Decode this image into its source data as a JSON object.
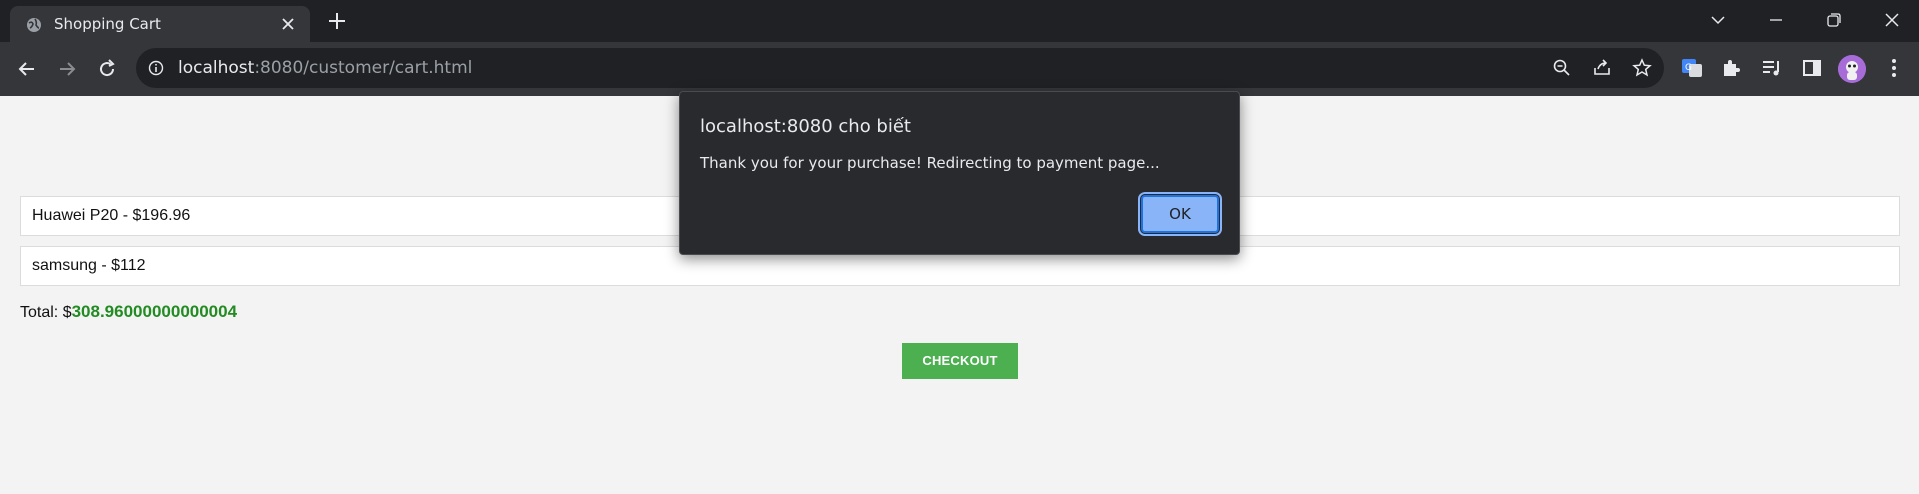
{
  "browser": {
    "tab_title": "Shopping Cart",
    "url_host": "localhost",
    "url_rest": ":8080/customer/cart.html"
  },
  "cart": {
    "items": [
      {
        "label": "Huawei P20 - $196.96"
      },
      {
        "label": "samsung - $112"
      }
    ],
    "total_label": "Total: $",
    "total_value": "308.96000000000004",
    "checkout_label": "CHECKOUT"
  },
  "dialog": {
    "title": "localhost:8080 cho biết",
    "message": "Thank you for your purchase! Redirecting to payment page...",
    "ok_label": "OK"
  },
  "icons": {
    "tab_favicon": "globe-icon",
    "tab_close": "close-icon",
    "new_tab": "plus-icon",
    "back": "arrow-left-icon",
    "forward": "arrow-right-icon",
    "reload": "reload-icon",
    "site_info": "info-icon",
    "zoom": "zoom-out-icon",
    "share": "share-icon",
    "bookmark": "star-icon",
    "translate": "translate-icon",
    "extensions": "puzzle-icon",
    "media": "playlist-icon",
    "side_panel": "side-panel-icon",
    "menu": "kebab-menu-icon"
  },
  "colors": {
    "total_value": "#228b22",
    "checkout_bg": "#4caf50",
    "dialog_bg": "#292a2d",
    "ok_bg": "#8ab4f8",
    "chrome_bg": "#202124",
    "toolbar_bg": "#35363a"
  }
}
